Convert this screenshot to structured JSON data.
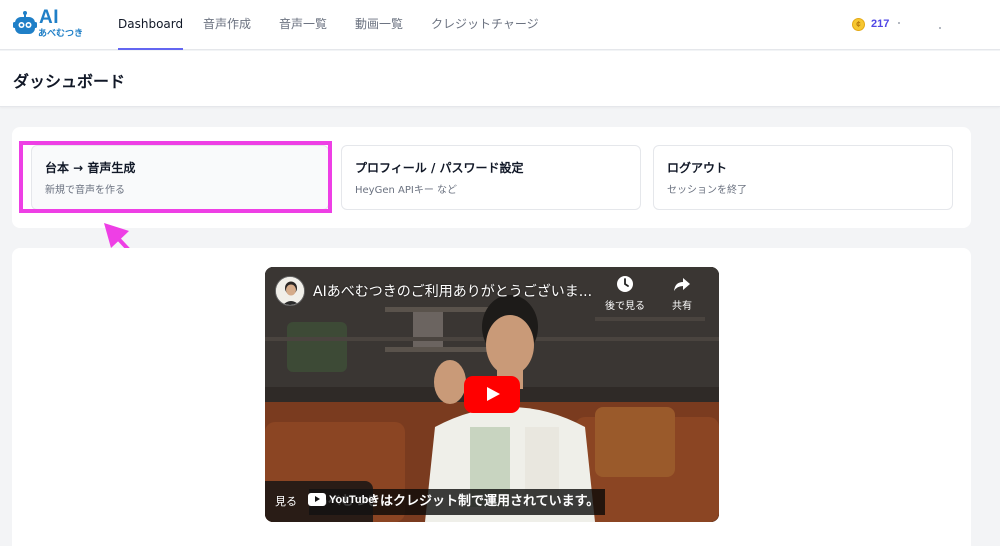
{
  "app": {
    "logo_main": "AI",
    "logo_sub": "あべむつき"
  },
  "nav": {
    "items": [
      {
        "label": "Dashboard",
        "active": true
      },
      {
        "label": "音声作成",
        "active": false
      },
      {
        "label": "音声一覧",
        "active": false
      },
      {
        "label": "動画一覧",
        "active": false
      },
      {
        "label": "クレジットチャージ",
        "active": false
      }
    ],
    "credits": "217",
    "coin_icon": "coin-icon",
    "accent_color": "#6366f1"
  },
  "page": {
    "title": "ダッシュボード"
  },
  "cards": [
    {
      "title": "台本 → 音声生成",
      "subtitle": "新規で音声を作る"
    },
    {
      "title": "プロフィール / パスワード設定",
      "subtitle": "HeyGen APIキー など"
    },
    {
      "title": "ログアウト",
      "subtitle": "セッションを終了"
    }
  ],
  "annotation": {
    "highlight_color": "#ee3fe5"
  },
  "video": {
    "title": "AIあべむつきのご利用ありがとうございま...",
    "watch_later_label": "後で見る",
    "share_label": "共有",
    "subtitle": "あべむつきはクレジット制で運用されています。",
    "watch_on": "見る",
    "youtube": "YouTube",
    "play_icon": "play-icon",
    "brand_color": "#ff0000"
  }
}
